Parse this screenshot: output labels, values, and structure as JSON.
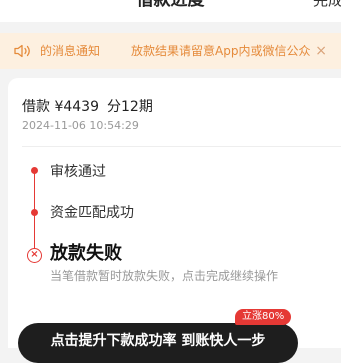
{
  "nav": {
    "title": "借款进度",
    "action_label": "完成"
  },
  "notice": {
    "icon": "speaker-icon",
    "text_1": "的消息通知",
    "text_2": "放款结果请留意App内或微信公众",
    "close_label": "×",
    "color": "#e58a3a",
    "background": "#fdf0e0"
  },
  "loan": {
    "amount_label": "借款 ¥4439",
    "term_label": "分12期",
    "datetime": "2024-11-06 10:54:29"
  },
  "timeline": {
    "steps": [
      {
        "label": "审核通过",
        "status": "done"
      },
      {
        "label": "资金匹配成功",
        "status": "done"
      }
    ],
    "current": {
      "status_icon": "x-circle-icon",
      "title": "放款失败",
      "description": "当笔借款暂时放款失败，点击完成继续操作"
    },
    "accent_color": "#e53935"
  },
  "cta": {
    "label": "点击提升下款成功率 到账快人一步",
    "badge": "立涨80%"
  }
}
